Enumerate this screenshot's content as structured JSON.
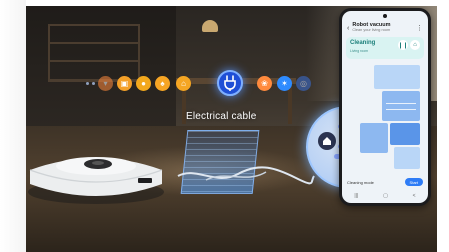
{
  "scene": {
    "cable_label": "Electrical cable",
    "object_icons": [
      {
        "name": "shoe-icon",
        "color": "#ff8a3d",
        "glyph": "▾"
      },
      {
        "name": "bag-icon",
        "color": "#f4a028",
        "glyph": "▣"
      },
      {
        "name": "pet-bowl-icon",
        "color": "#f2a81d",
        "glyph": "●"
      },
      {
        "name": "sock-icon",
        "color": "#f7a524",
        "glyph": "♠"
      },
      {
        "name": "person-icon",
        "color": "#f5a623",
        "glyph": "⌂"
      },
      {
        "name": "electrical-cable-icon",
        "color": "#1f4fd6",
        "glyph": ""
      },
      {
        "name": "pet-waste-icon",
        "color": "#ff8a3d",
        "glyph": "❀"
      },
      {
        "name": "toy-icon",
        "color": "#2e8bff",
        "glyph": "✶"
      },
      {
        "name": "scale-icon",
        "color": "#3a6fd8",
        "glyph": "◎"
      }
    ],
    "highlight_color": "#1f4fd6"
  },
  "phone": {
    "app_title": "Robot vacuum",
    "app_subtitle": "Clean your living room",
    "status_title": "Cleaning",
    "status_sub": "Living room",
    "bottom_label": "Cleaning mode",
    "start_label": "Start",
    "nav_icons": [
      "menu-icon",
      "home-icon",
      "back-icon"
    ],
    "nav_glyphs": [
      "|||",
      "▢",
      "<"
    ],
    "accent_color": "#2e7cf6",
    "card_color": "#d9f3f2"
  }
}
